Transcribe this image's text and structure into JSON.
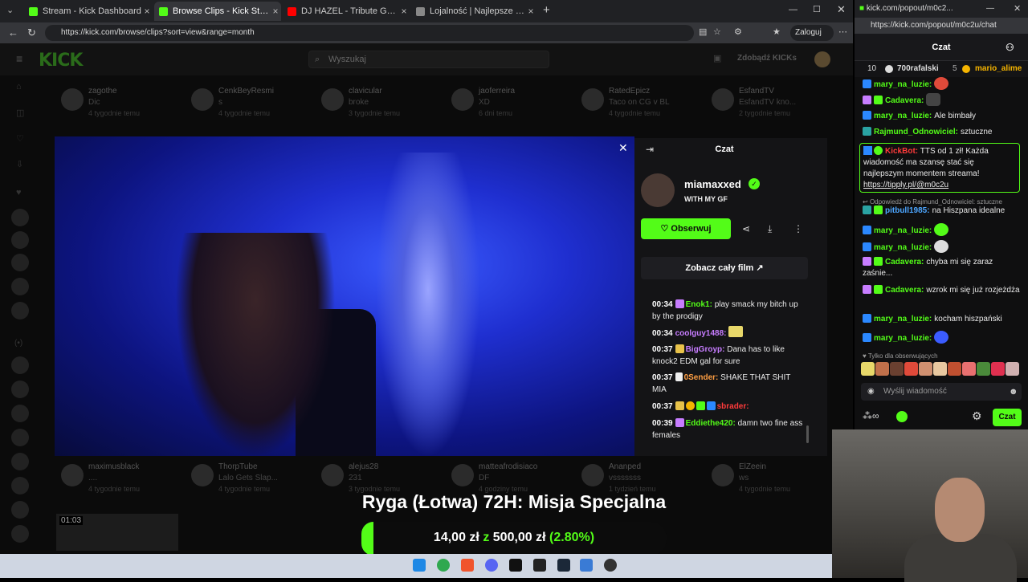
{
  "browser": {
    "tabs": [
      {
        "label": "Stream - Kick Dashboard",
        "color": "#53fc18"
      },
      {
        "label": "Browse Clips - Kick Streaming",
        "color": "#53fc18"
      },
      {
        "label": "DJ HAZEL - Tribute Great Song (M",
        "color": "#ff0000"
      },
      {
        "label": "Lojalność | Najlepsze oprogramo",
        "color": "#888888"
      }
    ],
    "url": "https://kick.com/browse/clips?sort=view&range=month",
    "login_label": "Zaloguj"
  },
  "kick": {
    "search_placeholder": "Wyszukaj",
    "get_kicks": "Zdobądź KICKs",
    "top_clips": [
      {
        "name": "zagothe",
        "title": "Dic",
        "date": "4 tygodnie temu"
      },
      {
        "name": "CenkBeyResmi",
        "title": "s",
        "date": "4 tygodnie temu"
      },
      {
        "name": "clavicular",
        "title": "broke",
        "date": "3 tygodnie temu"
      },
      {
        "name": "jaoferreira",
        "title": "XD",
        "date": "6 dni temu"
      },
      {
        "name": "RatedEpicz",
        "title": "Taco on CG v BL",
        "date": "4 tygodnie temu"
      },
      {
        "name": "EsfandTV",
        "title": "EsfandTV kno...",
        "date": "2 tygodnie temu"
      }
    ],
    "bottom_clips": [
      {
        "name": "maximusblack",
        "title": "....",
        "date": "4 tygodnie temu"
      },
      {
        "name": "ThorpTube",
        "title": "Lalo Gets Slap...",
        "date": "4 tygodnie temu"
      },
      {
        "name": "alejus28",
        "title": "231",
        "date": "3 tygodnie temu"
      },
      {
        "name": "matteafrodisiaco",
        "title": "DF",
        "date": "4 godziny temu"
      },
      {
        "name": "Ananped",
        "title": "vsssssss",
        "date": "1 tydzień temu"
      },
      {
        "name": "ElZeein",
        "title": "ws",
        "date": "4 tygodnie temu"
      }
    ],
    "clip_duration": "01:03"
  },
  "panel": {
    "header": "Czat",
    "streamer": "miamaxxed",
    "clip_title": "WITH MY GF",
    "follow_label": "Obserwuj",
    "full_film_label": "Zobacz cały film",
    "messages": [
      {
        "time": "00:34",
        "user": "Enok1:",
        "user_color": "#53fc18",
        "text": "play smack my bitch up by the prodigy"
      },
      {
        "time": "00:34",
        "user": "coolguy1488:",
        "user_color": "#c77dff",
        "text": ""
      },
      {
        "time": "00:37",
        "user": "BigGroyp:",
        "user_color": "#c77dff",
        "text": "Dana has to like knock2 EDM gal for sure"
      },
      {
        "time": "00:37",
        "user": "0Sender:",
        "user_color": "#ff9f43",
        "text": "SHAKE THAT SHIT MIA"
      },
      {
        "time": "00:37",
        "user": "sbrader:",
        "user_color": "#ff3b3b",
        "text": ""
      },
      {
        "time": "00:39",
        "user": "Eddiethe420:",
        "user_color": "#53fc18",
        "text": "damn two fine ass females"
      }
    ]
  },
  "overlay": {
    "title": "Ryga (Łotwa) 72H: Misja Specjalna",
    "current": "14,00 zł",
    "sep": "z",
    "goal": "500,00 zł",
    "percent_label": "(2.80%)",
    "progress": 0.028
  },
  "popout": {
    "tab_title": "kick.com/popout/m0c2...",
    "url": "https://kick.com/popout/m0c2u/chat",
    "header": "Czat",
    "leaderboard": {
      "rank": "10",
      "user1": "700rafalski",
      "count1": "5",
      "user2": "mario_alime"
    },
    "messages": [
      {
        "user": "mary_na_luzie:",
        "color": "#53fc18",
        "text": ""
      },
      {
        "user": "Cadavera:",
        "color": "#53fc18",
        "text": ""
      },
      {
        "user": "mary_na_luzie:",
        "color": "#53fc18",
        "text": "Ale bimbały"
      },
      {
        "user": "Rajmund_Odnowiciel:",
        "color": "#53fc18",
        "text": "sztuczne"
      },
      {
        "user": "pitbull1985:",
        "color": "#4da6ff",
        "text": "na Hiszpana idealne"
      },
      {
        "user": "mary_na_luzie:",
        "color": "#53fc18",
        "text": ""
      },
      {
        "user": "mary_na_luzie:",
        "color": "#53fc18",
        "text": ""
      },
      {
        "user": "Cadavera:",
        "color": "#53fc18",
        "text": "chyba mi się zaraz zaśnie..."
      },
      {
        "user": "Cadavera:",
        "color": "#53fc18",
        "text": "wzrok mi się już rozjeżdża"
      },
      {
        "user": "mary_na_luzie:",
        "color": "#53fc18",
        "text": "kocham hiszpański"
      },
      {
        "user": "mary_na_luzie:",
        "color": "#53fc18",
        "text": ""
      }
    ],
    "tip": {
      "user": "KickBot:",
      "text": "TTS od 1 zł! Każda wiadomość ma szansę stać się najlepszym momentem streama!",
      "link": "https://tipply.pl/@m0c2u"
    },
    "reply_note": "Odpowiedź do Rajmund_Odnowiciel: sztuczne",
    "followers_only": "Tylko dla obserwujących",
    "input_placeholder": "Wyślij wiadomość",
    "send_label": "Czat"
  },
  "colors": {
    "accent": "#53fc18"
  }
}
